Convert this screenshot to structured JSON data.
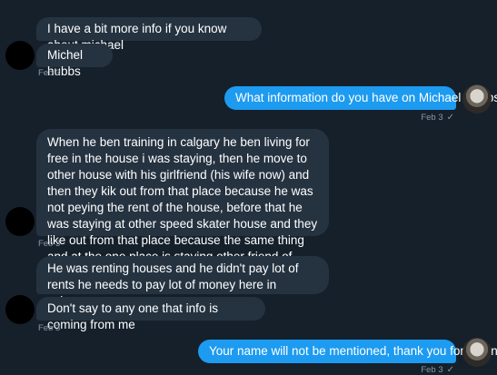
{
  "messages": [
    {
      "id": "m1",
      "direction": "in",
      "text": "I have a bit more info if you know about michael"
    },
    {
      "id": "m2",
      "direction": "in",
      "text": "Michel hubbs"
    },
    {
      "id": "m3",
      "direction": "out",
      "text": "What information do you have on Michael Hubbs?"
    },
    {
      "id": "m4",
      "direction": "in",
      "text": "When he ben training in calgary he ben living for free in the house i was staying, then he move to other house with his girlfriend (his wife now) and then they kik out from that place because he was not peying the rent of the house, before that he was staying at other speed skater house and they like out from that place because the same thing and at the one place is staying other friend of mine they kik out to for the same reason"
    },
    {
      "id": "m5",
      "direction": "in",
      "text": "He was renting houses and he didn't pay lot of rents he needs to pay lot of money here in calgary"
    },
    {
      "id": "m6",
      "direction": "in",
      "text": "Don't say to any one that info is coming from me"
    },
    {
      "id": "m7",
      "direction": "out",
      "text": "Your name will not be mentioned, thank you for the info!"
    }
  ],
  "timestamps": {
    "t1": "Feb 3",
    "t2": "Feb 3",
    "t3": "Feb 3",
    "t4": "Feb 3",
    "t5": "Feb 3"
  },
  "read_receipt": "✓",
  "colors": {
    "background": "#15202b",
    "incoming": "#253341",
    "outgoing": "#1d9bf0",
    "meta": "#8899a6"
  }
}
